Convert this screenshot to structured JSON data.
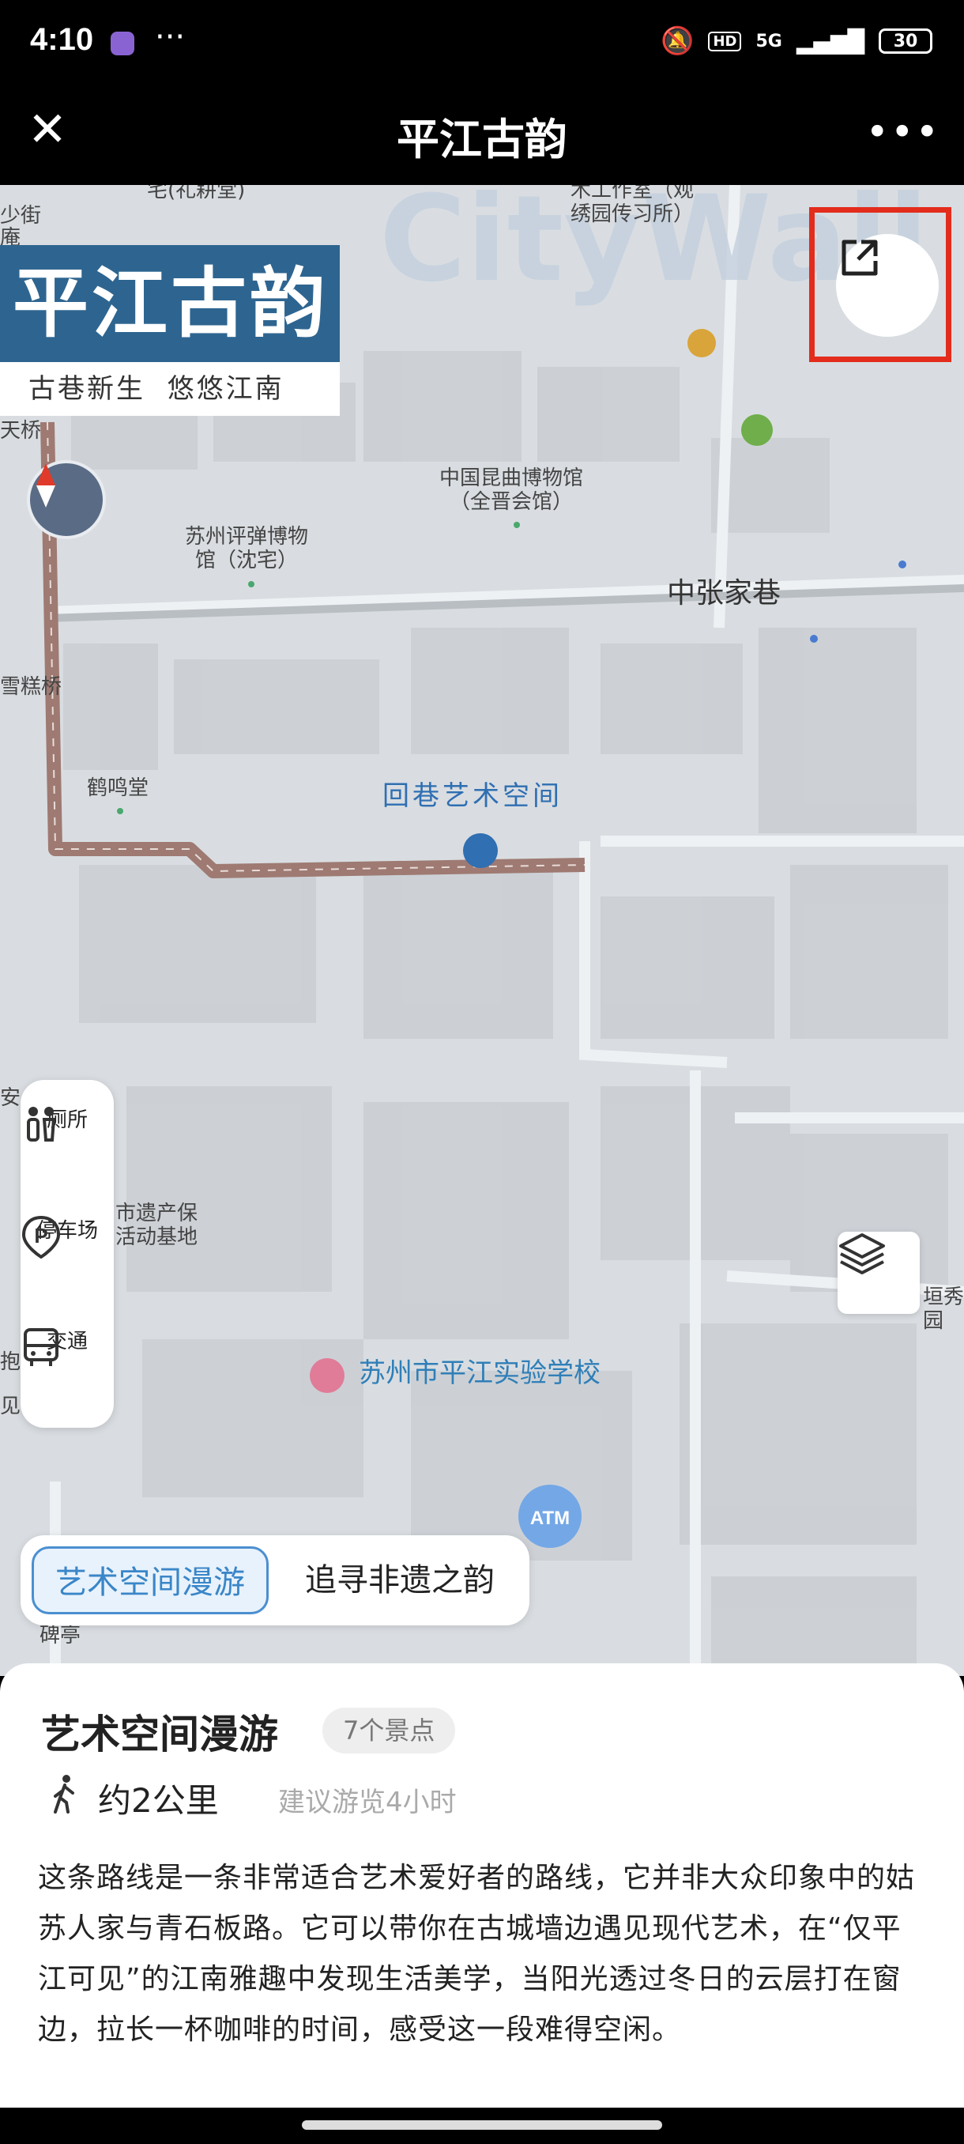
{
  "status_bar": {
    "time": "4:10",
    "dots": "···",
    "hd": "HD",
    "network": "5G",
    "battery": "30"
  },
  "nav": {
    "title": "平江古韵",
    "close_icon": "close-icon",
    "more_icon": "more-icon"
  },
  "map": {
    "banner_title": "平江古韵",
    "banner_subtitle": "古巷新生  悠悠江南",
    "watermark": "CityWall",
    "labels": {
      "kunqu_museum": "中国昆曲博物馆\n（全晋会馆）",
      "pingtan_museum": "苏州评弹博物\n馆（沈宅）",
      "zhongzhangjia": "中张家巷",
      "heming": "鹤鸣堂",
      "huixiang": "回巷艺术空间",
      "heritage": "市遗产保\n活动基地",
      "school": "苏州市平江实验学校",
      "atm": "ATM",
      "top_studio": "木工作室（观\n绣园传习所）",
      "top_left1": "宅(礼耕堂)",
      "top_left2": "少街",
      "top_left3": "庵",
      "tianqiao": "天桥",
      "gaoqiao": "雪糕桥",
      "bei": "碑亭",
      "an": "安",
      "bao": "抱",
      "jian": "见",
      "park": "垣秀园"
    }
  },
  "poi_panel": [
    {
      "icon": "toilet-icon",
      "label": "厕所"
    },
    {
      "icon": "parking-icon",
      "label": "停车场"
    },
    {
      "icon": "bus-icon",
      "label": "交通"
    }
  ],
  "route_tabs": {
    "active": "艺术空间漫游",
    "other": "追寻非遗之韵"
  },
  "route": {
    "title": "艺术空间漫游",
    "spots": "7个景点",
    "distance": "约2公里",
    "duration": "建议游览4小时",
    "description": "这条路线是一条非常适合艺术爱好者的路线，它并非大众印象中的姑苏人家与青石板路。它可以带你在古城墙边遇见现代艺术，在“仅平江可见”的江南雅趣中发现生活美学，当阳光透过冬日的云层打在窗边，拉长一杯咖啡的时间，感受这一段难得空闲。"
  },
  "colors": {
    "banner_blue": "#2e6590",
    "route_line": "#9e7a72",
    "highlight_red": "#e32c1c",
    "tab_blue": "#3a86c8"
  }
}
